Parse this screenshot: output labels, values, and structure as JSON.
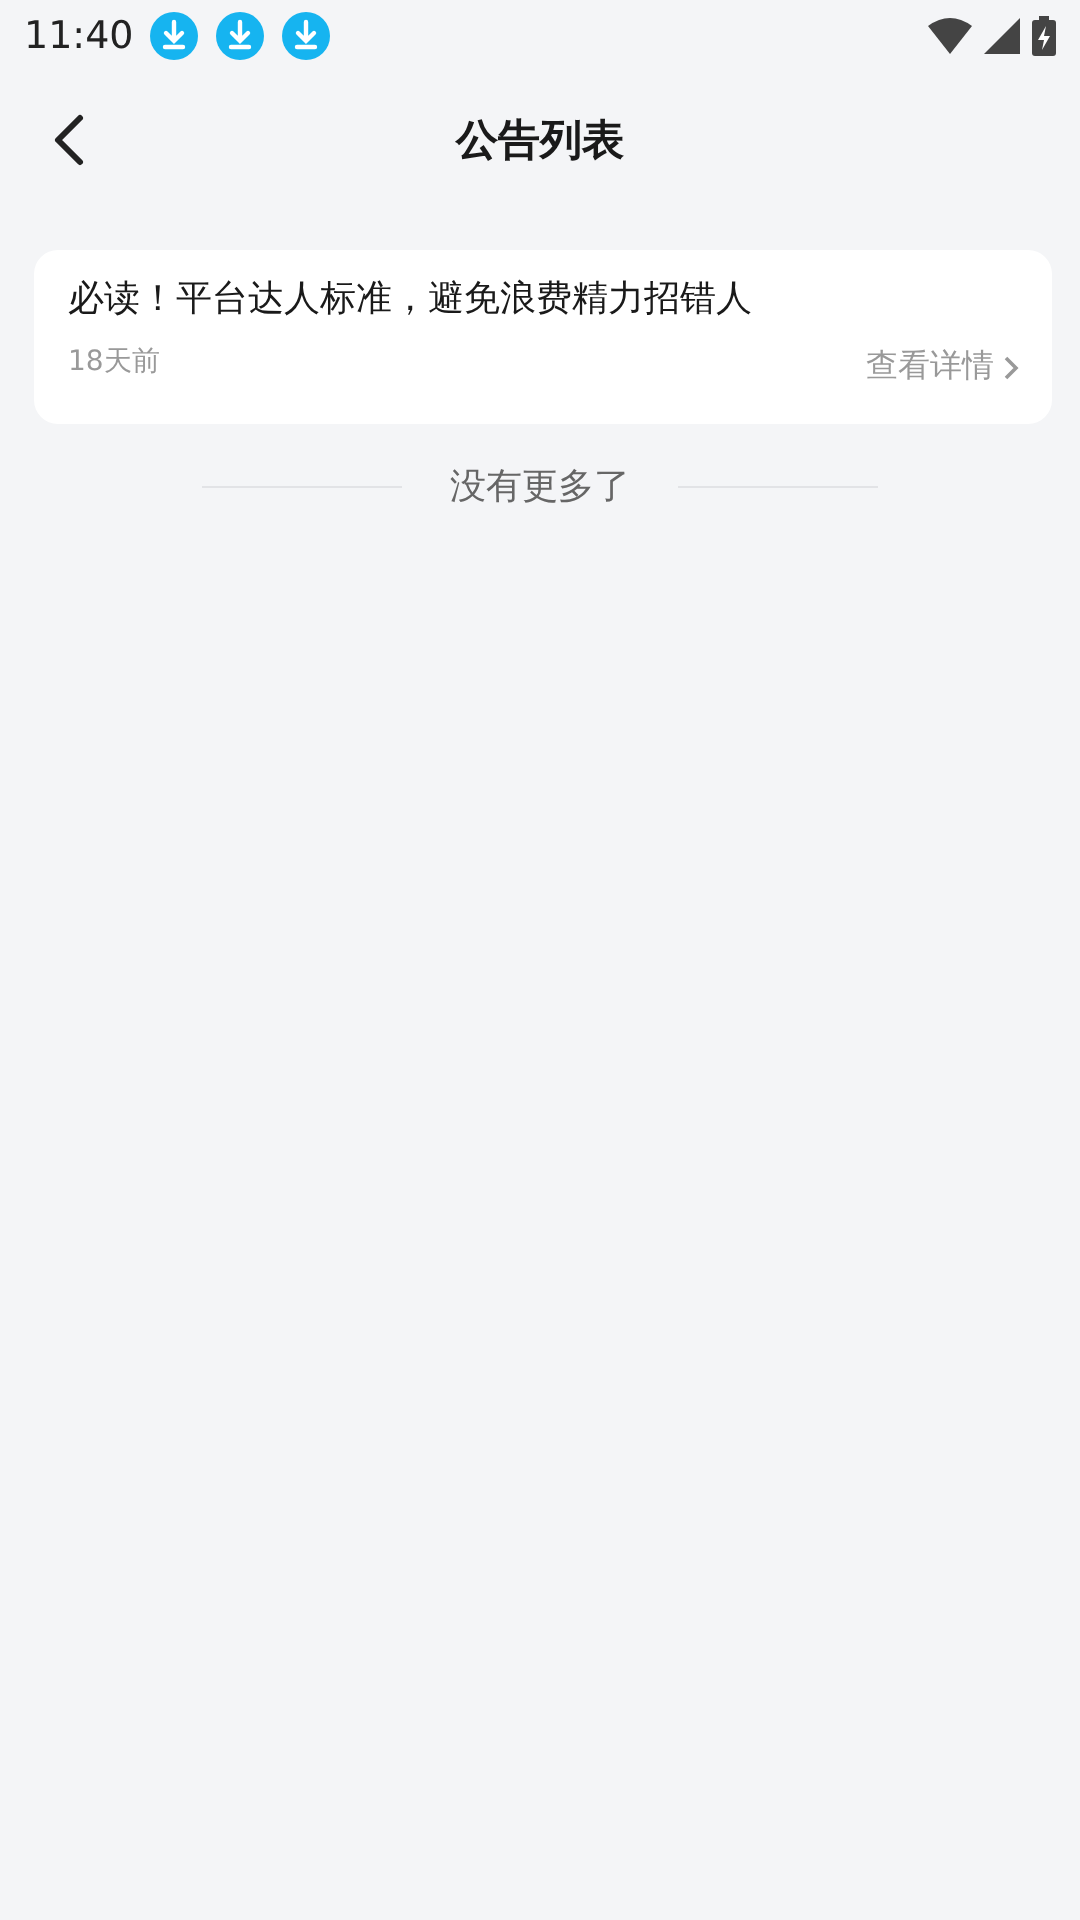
{
  "status_bar": {
    "time": "11:40",
    "notifications": [
      {
        "kind": "download"
      },
      {
        "kind": "download"
      },
      {
        "kind": "download"
      }
    ]
  },
  "header": {
    "title": "公告列表"
  },
  "notices": [
    {
      "title": "必读！平台达人标准，避免浪费精力招错人",
      "time": "18天前",
      "link": "查看详情"
    }
  ],
  "end_text": "没有更多了"
}
